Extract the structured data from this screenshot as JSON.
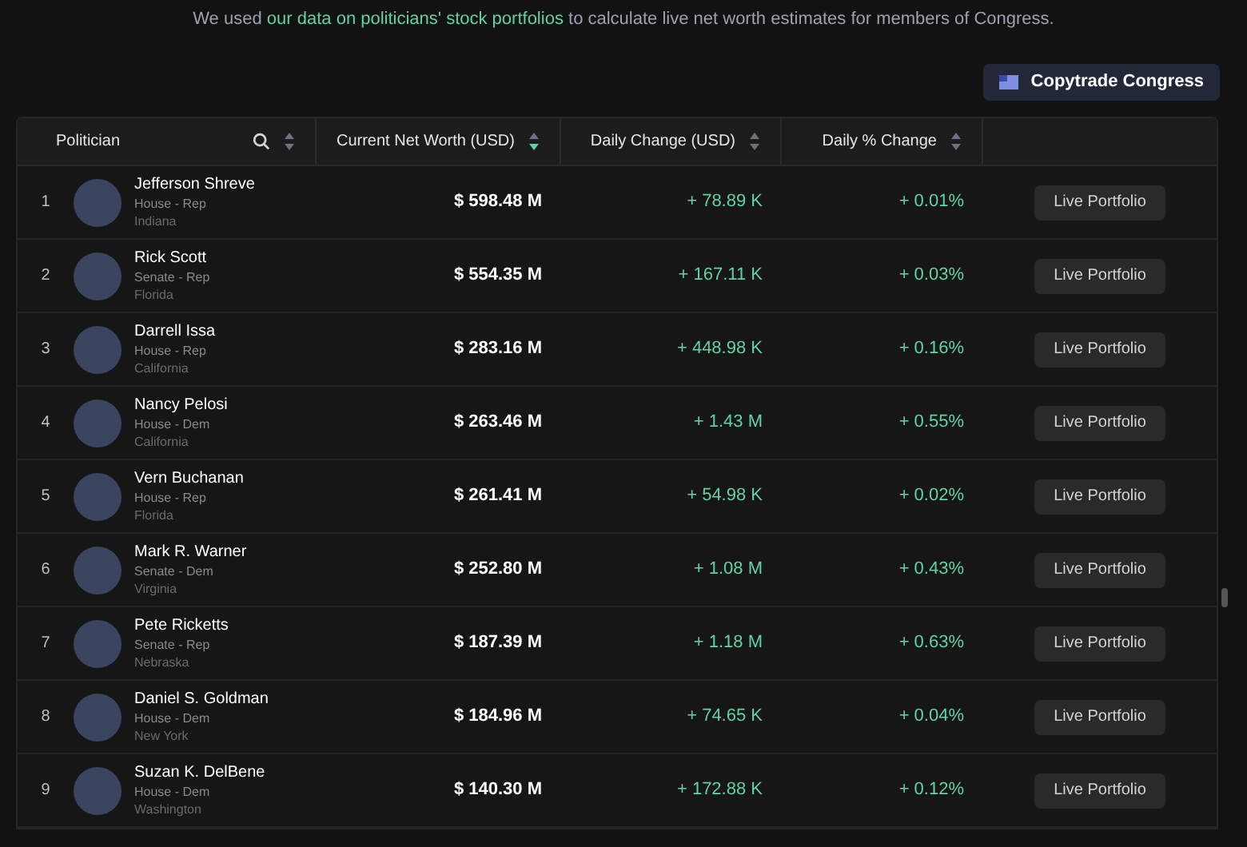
{
  "intro": {
    "before": "We used ",
    "link": "our data on politicians' stock portfolios",
    "after": " to calculate live net worth estimates for members of Congress."
  },
  "copytrade_button": "Copytrade Congress",
  "table": {
    "columns": [
      {
        "label": "Politician",
        "searchable": true,
        "sorted": false
      },
      {
        "label": "Current Net Worth (USD)",
        "searchable": false,
        "sorted": true
      },
      {
        "label": "Daily Change (USD)",
        "searchable": false,
        "sorted": false
      },
      {
        "label": "Daily % Change",
        "searchable": false,
        "sorted": false
      }
    ],
    "rows": [
      {
        "rank": "1",
        "name": "Jefferson Shreve",
        "chamber": "House - Rep",
        "state": "Indiana",
        "net_worth": "$ 598.48 M",
        "daily_change": "+ 78.89 K",
        "daily_pct": "+ 0.01%",
        "action": "Live Portfolio"
      },
      {
        "rank": "2",
        "name": "Rick Scott",
        "chamber": "Senate - Rep",
        "state": "Florida",
        "net_worth": "$ 554.35 M",
        "daily_change": "+ 167.11 K",
        "daily_pct": "+ 0.03%",
        "action": "Live Portfolio"
      },
      {
        "rank": "3",
        "name": "Darrell Issa",
        "chamber": "House - Rep",
        "state": "California",
        "net_worth": "$ 283.16 M",
        "daily_change": "+ 448.98 K",
        "daily_pct": "+ 0.16%",
        "action": "Live Portfolio"
      },
      {
        "rank": "4",
        "name": "Nancy Pelosi",
        "chamber": "House - Dem",
        "state": "California",
        "net_worth": "$ 263.46 M",
        "daily_change": "+ 1.43 M",
        "daily_pct": "+ 0.55%",
        "action": "Live Portfolio"
      },
      {
        "rank": "5",
        "name": "Vern Buchanan",
        "chamber": "House - Rep",
        "state": "Florida",
        "net_worth": "$ 261.41 M",
        "daily_change": "+ 54.98 K",
        "daily_pct": "+ 0.02%",
        "action": "Live Portfolio"
      },
      {
        "rank": "6",
        "name": "Mark R. Warner",
        "chamber": "Senate - Dem",
        "state": "Virginia",
        "net_worth": "$ 252.80 M",
        "daily_change": "+ 1.08 M",
        "daily_pct": "+ 0.43%",
        "action": "Live Portfolio"
      },
      {
        "rank": "7",
        "name": "Pete Ricketts",
        "chamber": "Senate - Rep",
        "state": "Nebraska",
        "net_worth": "$ 187.39 M",
        "daily_change": "+ 1.18 M",
        "daily_pct": "+ 0.63%",
        "action": "Live Portfolio"
      },
      {
        "rank": "8",
        "name": "Daniel S. Goldman",
        "chamber": "House - Dem",
        "state": "New York",
        "net_worth": "$ 184.96 M",
        "daily_change": "+ 74.65 K",
        "daily_pct": "+ 0.04%",
        "action": "Live Portfolio"
      },
      {
        "rank": "9",
        "name": "Suzan K. DelBene",
        "chamber": "House - Dem",
        "state": "Washington",
        "net_worth": "$ 140.30 M",
        "daily_change": "+ 172.88 K",
        "daily_pct": "+ 0.12%",
        "action": "Live Portfolio"
      }
    ]
  }
}
